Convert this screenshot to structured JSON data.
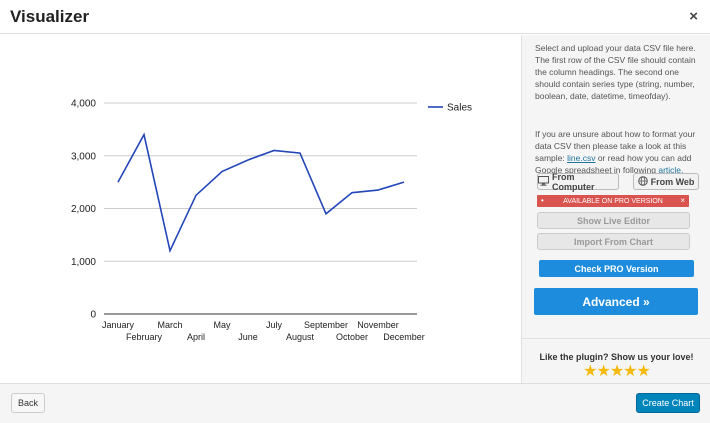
{
  "header": {
    "title": "Visualizer",
    "close_icon": "close-icon",
    "close_glyph": "×"
  },
  "sidebar": {
    "instructions": "Select and upload your data CSV file here. The first row of the CSV file should contain the column headings. The second one should contain series type (string, number, boolean, date, datetime, timeofday).",
    "help_prefix": "If you are unsure about how to format your data CSV then please take a look at this sample: ",
    "sample_link": "line.csv",
    "help_middle": " or read how you can add Google spreadsheet in following ",
    "article_link": "article.",
    "from_computer": "From Computer",
    "from_web": "From Web",
    "pro_banner": "AVAILABLE ON PRO VERSION",
    "show_live_editor": "Show Live Editor",
    "import_from_chart": "Import From Chart",
    "check_pro": "Check PRO Version",
    "advanced": "Advanced »",
    "love_text": "Like the plugin? Show us your love!",
    "stars": "★★★★★",
    "rating": 5
  },
  "footer": {
    "back": "Back",
    "create": "Create Chart"
  },
  "colors": {
    "line": "#2346b8",
    "accent": "#1e8cdd",
    "create": "#0085ba",
    "pro": "#d9534f",
    "star": "#f5b90a"
  },
  "chart_data": {
    "type": "line",
    "categories": [
      "January",
      "February",
      "March",
      "April",
      "May",
      "June",
      "July",
      "August",
      "September",
      "October",
      "November",
      "December"
    ],
    "series": [
      {
        "name": "Sales",
        "values": [
          2500,
          3400,
          1200,
          2250,
          2700,
          2920,
          3100,
          3050,
          1900,
          2300,
          2350,
          2500
        ]
      }
    ],
    "ylim": [
      0,
      4000
    ],
    "yticks": [
      0,
      1000,
      2000,
      3000,
      4000
    ],
    "ytick_labels": [
      "0",
      "1,000",
      "2,000",
      "3,000",
      "4,000"
    ],
    "legend": "right",
    "grid": true
  }
}
